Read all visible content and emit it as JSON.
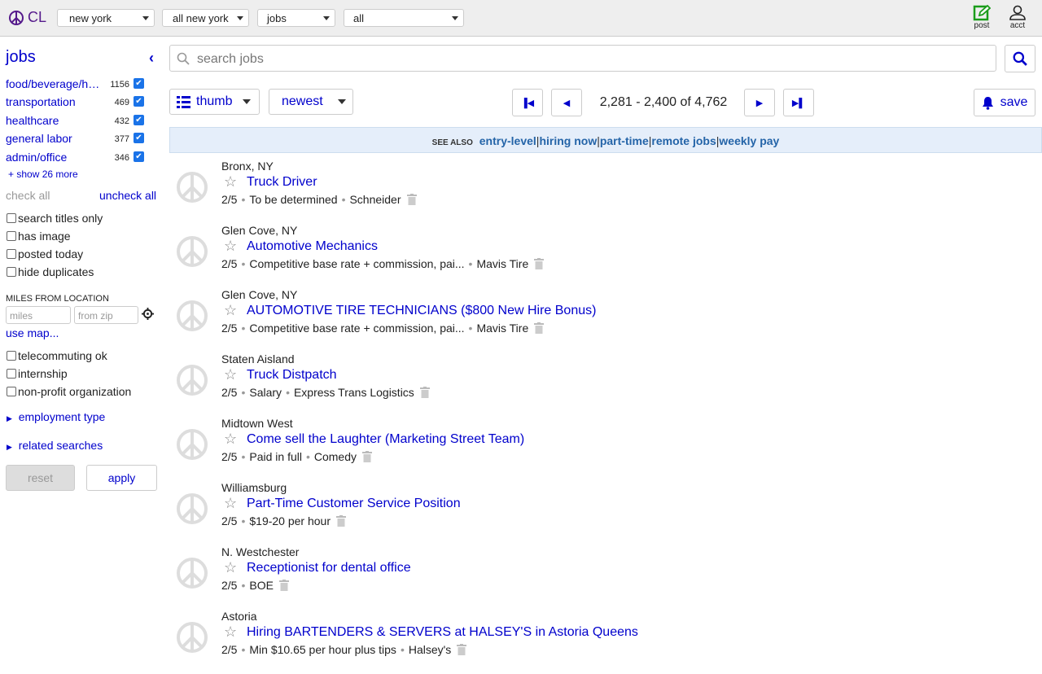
{
  "header": {
    "logo": "CL",
    "selects": [
      "new york",
      "all new york",
      "jobs",
      "all"
    ],
    "post": "post",
    "acct": "acct"
  },
  "sidebar": {
    "title": "jobs",
    "categories": [
      {
        "name": "food/beverage/hospitality",
        "count": "1156"
      },
      {
        "name": "transportation",
        "count": "469"
      },
      {
        "name": "healthcare",
        "count": "432"
      },
      {
        "name": "general labor",
        "count": "377"
      },
      {
        "name": "admin/office",
        "count": "346"
      }
    ],
    "show_more": "+ show 26 more",
    "check_all": "check all",
    "uncheck_all": "uncheck all",
    "filters": [
      "search titles only",
      "has image",
      "posted today",
      "hide duplicates"
    ],
    "miles_label": "MILES FROM LOCATION",
    "miles_placeholder": "miles",
    "zip_placeholder": "from zip",
    "use_map": "use map...",
    "filters2": [
      "telecommuting ok",
      "internship",
      "non-profit organization"
    ],
    "employment_type": "employment type",
    "related_searches": "related searches",
    "reset": "reset",
    "apply": "apply"
  },
  "search": {
    "placeholder": "search jobs"
  },
  "toolbar": {
    "view": "thumb",
    "sort": "newest",
    "range": "2,281 - 2,400 of 4,762",
    "save": "save"
  },
  "see_also": {
    "label": "SEE ALSO",
    "links": [
      "entry-level",
      "hiring now",
      "part-time",
      "remote jobs",
      "weekly pay"
    ]
  },
  "listings": [
    {
      "loc": "Bronx, NY",
      "title": "Truck Driver",
      "date": "2/5",
      "meta": [
        "To be determined",
        "Schneider"
      ]
    },
    {
      "loc": "Glen Cove, NY",
      "title": "Automotive Mechanics",
      "date": "2/5",
      "meta": [
        "Competitive base rate + commission, pai...",
        "Mavis Tire"
      ]
    },
    {
      "loc": "Glen Cove, NY",
      "title": "AUTOMOTIVE TIRE TECHNICIANS ($800 New Hire Bonus)",
      "date": "2/5",
      "meta": [
        "Competitive base rate + commission, pai...",
        "Mavis Tire"
      ]
    },
    {
      "loc": "Staten Aisland",
      "title": "Truck Distpatch",
      "date": "2/5",
      "meta": [
        "Salary",
        "Express Trans Logistics"
      ]
    },
    {
      "loc": "Midtown West",
      "title": "Come sell the Laughter (Marketing Street Team)",
      "date": "2/5",
      "meta": [
        "Paid in full",
        "Comedy"
      ]
    },
    {
      "loc": "Williamsburg",
      "title": "Part-Time Customer Service Position",
      "date": "2/5",
      "meta": [
        "$19-20 per hour"
      ]
    },
    {
      "loc": "N. Westchester",
      "title": "Receptionist for dental office",
      "date": "2/5",
      "meta": [
        "BOE"
      ]
    },
    {
      "loc": "Astoria",
      "title": "Hiring BARTENDERS & SERVERS at HALSEY'S in Astoria Queens",
      "date": "2/5",
      "meta": [
        "Min $10.65 per hour plus tips",
        "Halsey's"
      ]
    }
  ],
  "colors": {
    "link": "#0000cc",
    "logo": "#551a8b",
    "post": "#1a9c1a",
    "see_also_bg": "#e5eefa"
  }
}
